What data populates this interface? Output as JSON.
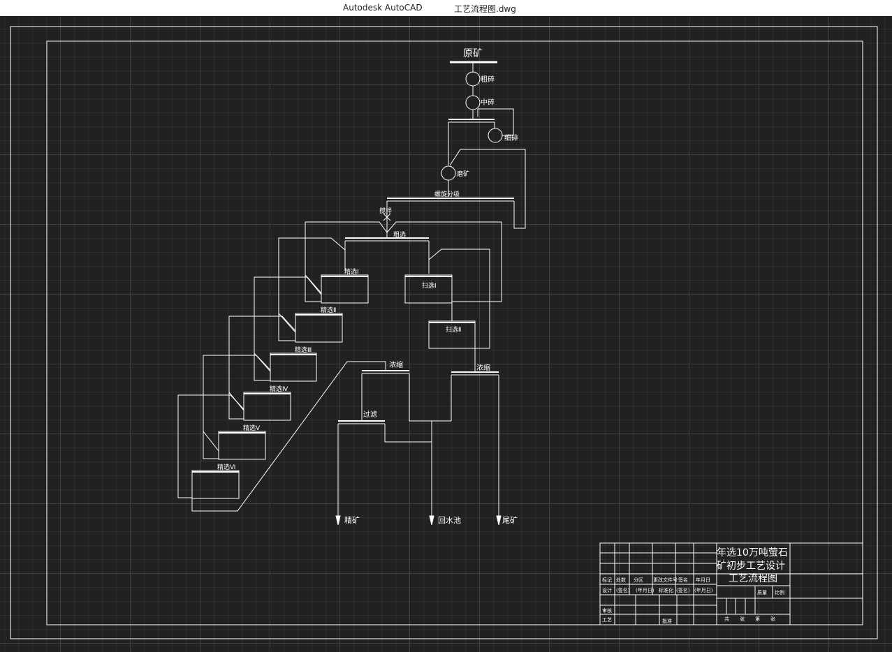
{
  "window": {
    "app_name": "Autodesk AutoCAD",
    "document_name": "工艺流程图.dwg"
  },
  "colors": {
    "canvas_bg": "#212121",
    "line": "#ffffff",
    "grid_major": "#3b3f48",
    "grid_minor": "#2a2d33"
  },
  "flowsheet": {
    "raw_ore": "原矿",
    "coarse_crush": "粗碎",
    "medium_crush": "中碎",
    "fine_crush": "细碎",
    "grinding": "磨矿",
    "spiral_classify": "螺旋分级",
    "agitate": "搅拌",
    "rougher": "粗选",
    "cleaner_1": "精选Ⅰ",
    "cleaner_2": "精选Ⅱ",
    "cleaner_3": "精选Ⅲ",
    "cleaner_4": "精选Ⅳ",
    "cleaner_5": "精选Ⅴ",
    "cleaner_6": "精选Ⅵ",
    "scavenger_1": "扫选Ⅰ",
    "scavenger_2": "扫选Ⅱ",
    "thicken_1": "浓缩",
    "thicken_2": "浓缩",
    "filter": "过滤",
    "out_concentrate": "精矿",
    "out_return_water": "回水池",
    "out_tailings": "尾矿"
  },
  "title_block": {
    "project_line_1": "年选10万吨萤石",
    "project_line_2": "矿初步工艺设计",
    "drawing_name": "工艺流程图",
    "labels": {
      "mark": "标记",
      "count": "处数",
      "zone": "分区",
      "change_doc": "更改文件号",
      "sign": "签名",
      "date": "年月日",
      "design": "设计",
      "sign_paren": "(签名)",
      "date_paren": "(年月日)",
      "standardize": "标准化",
      "sign_paren_2": "(签名)",
      "date_paren_2": "(年月日)",
      "review": "审核",
      "process": "工艺",
      "approve": "批准",
      "weight": "质量",
      "scale": "比例",
      "total_sheets": "共",
      "sheets_unit": "张",
      "sheet_no": "第",
      "sheet_unit": "张"
    }
  }
}
